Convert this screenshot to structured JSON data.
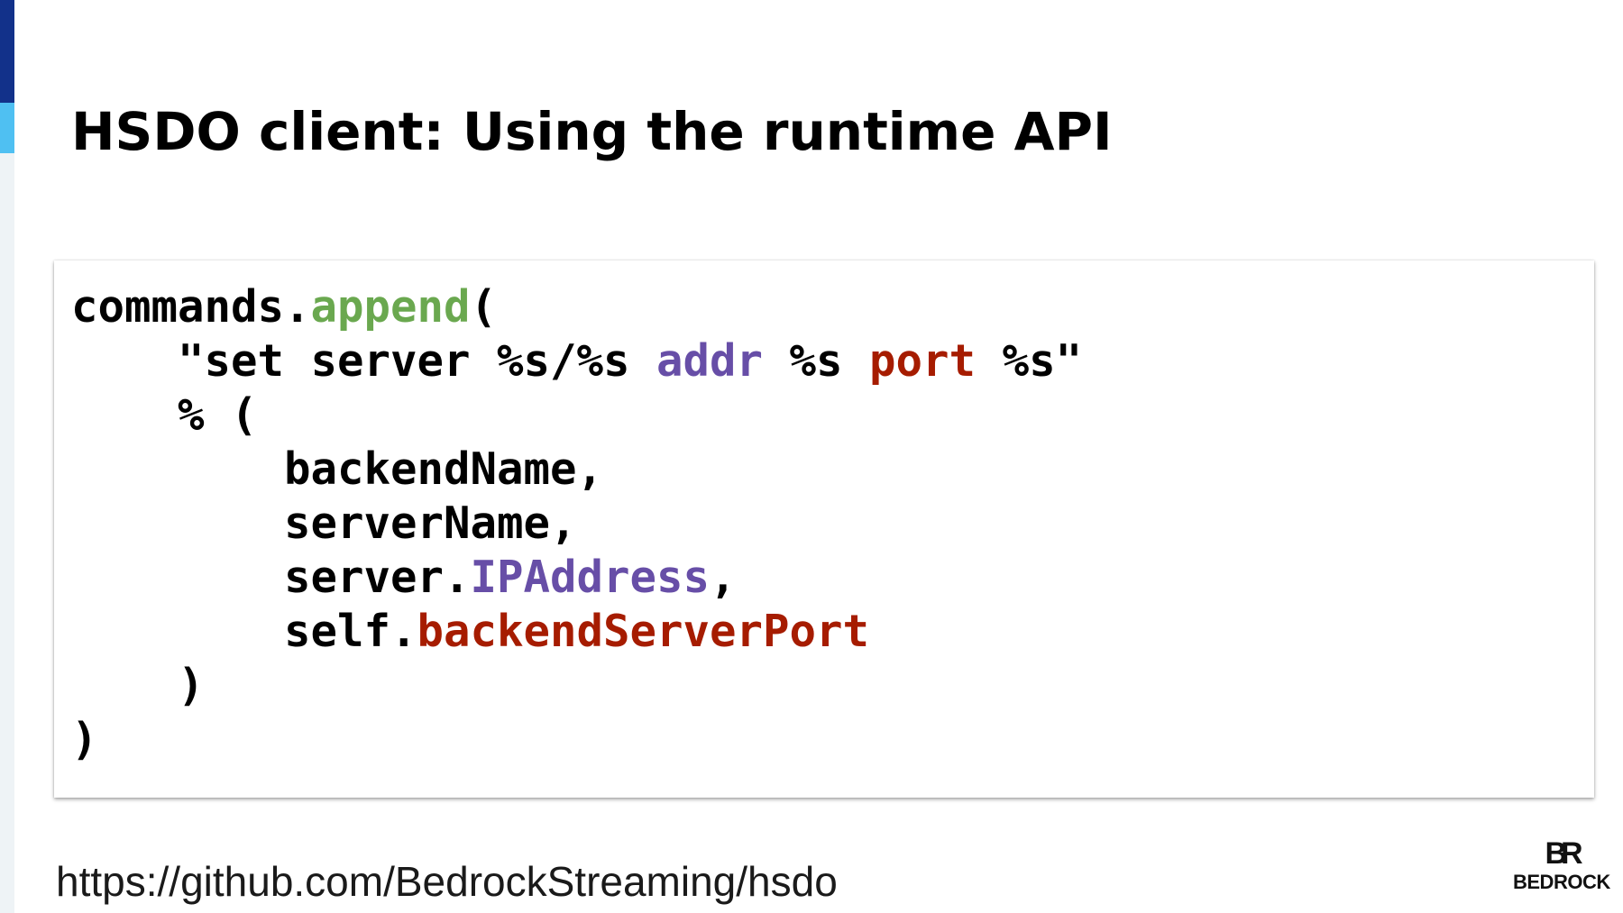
{
  "slide": {
    "title": "HSDO client: Using the runtime API",
    "accent_colors": {
      "dark": "#12318a",
      "light": "#4fc0f2"
    }
  },
  "code": {
    "colors": {
      "method": "#6aa84f",
      "keyword_purple": "#674ea7",
      "keyword_red": "#a61c00"
    },
    "line1": {
      "a": "commands.",
      "b": "append",
      "c": "("
    },
    "line2": {
      "a": "    \"set server %s/%s ",
      "b": "addr",
      "c": " %s ",
      "d": "port",
      "e": " %s\""
    },
    "line3": {
      "a": "    % ("
    },
    "line4": {
      "a": "        backendName,"
    },
    "line5": {
      "a": "        serverName,"
    },
    "line6": {
      "a": "        server.",
      "b": "IPAddress",
      "c": ","
    },
    "line7": {
      "a": "        self.",
      "b": "backendServerPort"
    },
    "line8": {
      "a": "    )"
    },
    "line9": {
      "a": ")"
    }
  },
  "footer": {
    "link_text": "https://github.com/BedrockStreaming/hsdo",
    "logo_mark": "BR",
    "logo_text": "BEDROCK"
  }
}
